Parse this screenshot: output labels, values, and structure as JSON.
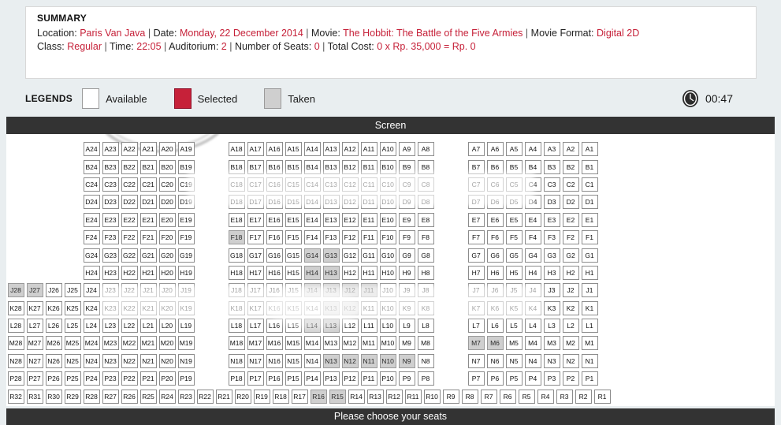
{
  "summary": {
    "title": "SUMMARY",
    "location_label": "Location:",
    "location_value": "Paris Van Java",
    "date_label": "Date:",
    "date_value": "Monday, 22 December 2014",
    "movie_label": "Movie:",
    "movie_value": "The Hobbit: The Battle of the Five Armies",
    "format_label": "Movie Format:",
    "format_value": "Digital 2D",
    "class_label": "Class:",
    "class_value": "Regular",
    "time_label": "Time:",
    "time_value": "22:05",
    "auditorium_label": "Auditorium:",
    "auditorium_value": "2",
    "seats_label": "Number of Seats:",
    "seats_value": "0",
    "cost_label": "Total Cost:",
    "cost_value": "0 x Rp. 35,000 = Rp. 0",
    "divider": "|"
  },
  "legends": {
    "label": "LEGENDS",
    "items": [
      {
        "name": "available",
        "text": "Available",
        "color": "#ffffff"
      },
      {
        "name": "selected",
        "text": "Selected",
        "color": "#c62139"
      },
      {
        "name": "taken",
        "text": "Taken",
        "color": "#cfcfcf"
      }
    ],
    "clock_icon": "clock-icon",
    "timer": "00:47"
  },
  "screen": {
    "label": "Screen"
  },
  "footer": {
    "message": "Please choose your seats"
  },
  "seatmap": {
    "taken_seats": [
      "F18",
      "G14",
      "G13",
      "H14",
      "H13",
      "J28",
      "J27",
      "J14",
      "J13",
      "J12",
      "J11",
      "K13",
      "K12",
      "L14",
      "L13",
      "M7",
      "M6",
      "N13",
      "N12",
      "N11",
      "N10",
      "N9",
      "R16",
      "R15"
    ],
    "selected_seats": [],
    "rows": [
      {
        "row": "A",
        "indent": 96,
        "left": [
          24,
          23,
          22,
          21,
          20,
          19
        ],
        "middle": [
          18,
          17,
          16,
          15,
          14,
          13,
          12,
          11,
          10,
          9,
          8
        ],
        "right": [
          7,
          6,
          5,
          4,
          3,
          2,
          1
        ]
      },
      {
        "row": "B",
        "indent": 96,
        "left": [
          24,
          23,
          22,
          21,
          20,
          19
        ],
        "middle": [
          18,
          17,
          16,
          15,
          14,
          13,
          12,
          11,
          10,
          9,
          8
        ],
        "right": [
          7,
          6,
          5,
          4,
          3,
          2,
          1
        ]
      },
      {
        "row": "C",
        "indent": 96,
        "left": [
          24,
          23,
          22,
          21,
          20,
          19
        ],
        "middle": [
          18,
          17,
          16,
          15,
          14,
          13,
          12,
          11,
          10,
          9,
          8
        ],
        "right": [
          7,
          6,
          5,
          4,
          3,
          2,
          1
        ]
      },
      {
        "row": "D",
        "indent": 96,
        "left": [
          24,
          23,
          22,
          21,
          20,
          19
        ],
        "middle": [
          18,
          17,
          16,
          15,
          14,
          13,
          12,
          11,
          10,
          9,
          8
        ],
        "right": [
          7,
          6,
          5,
          4,
          3,
          2,
          1
        ]
      },
      {
        "row": "E",
        "indent": 96,
        "left": [
          24,
          23,
          22,
          21,
          20,
          19
        ],
        "middle": [
          18,
          17,
          16,
          15,
          14,
          13,
          12,
          11,
          10,
          9,
          8
        ],
        "right": [
          7,
          6,
          5,
          4,
          3,
          2,
          1
        ]
      },
      {
        "row": "F",
        "indent": 96,
        "left": [
          24,
          23,
          22,
          21,
          20,
          19
        ],
        "middle": [
          18,
          17,
          16,
          15,
          14,
          13,
          12,
          11,
          10,
          9,
          8
        ],
        "right": [
          7,
          6,
          5,
          4,
          3,
          2,
          1
        ]
      },
      {
        "row": "G",
        "indent": 96,
        "left": [
          24,
          23,
          22,
          21,
          20,
          19
        ],
        "middle": [
          18,
          17,
          16,
          15,
          14,
          13,
          12,
          11,
          10,
          9,
          8
        ],
        "right": [
          7,
          6,
          5,
          4,
          3,
          2,
          1
        ]
      },
      {
        "row": "H",
        "indent": 96,
        "left": [
          24,
          23,
          22,
          21,
          20,
          19
        ],
        "middle": [
          18,
          17,
          16,
          15,
          14,
          13,
          12,
          11,
          10,
          9,
          8
        ],
        "right": [
          7,
          6,
          5,
          4,
          3,
          2,
          1
        ]
      },
      {
        "row": "J",
        "indent": 0,
        "left": [
          28,
          27,
          26,
          25,
          24,
          23,
          22,
          21,
          20,
          19
        ],
        "middle": [
          18,
          17,
          16,
          15,
          14,
          13,
          12,
          11,
          10,
          9,
          8
        ],
        "right": [
          7,
          6,
          5,
          4,
          3,
          2,
          1
        ]
      },
      {
        "row": "K",
        "indent": 0,
        "left": [
          28,
          27,
          26,
          25,
          24,
          23,
          22,
          21,
          20,
          19
        ],
        "middle": [
          18,
          17,
          16,
          15,
          14,
          13,
          12,
          11,
          10,
          9,
          8
        ],
        "right": [
          7,
          6,
          5,
          4,
          3,
          2,
          1
        ]
      },
      {
        "row": "L",
        "indent": 0,
        "left": [
          28,
          27,
          26,
          25,
          24,
          23,
          22,
          21,
          20,
          19
        ],
        "middle": [
          18,
          17,
          16,
          15,
          14,
          13,
          12,
          11,
          10,
          9,
          8
        ],
        "right": [
          7,
          6,
          5,
          4,
          3,
          2,
          1
        ]
      },
      {
        "row": "M",
        "indent": 0,
        "left": [
          28,
          27,
          26,
          25,
          24,
          23,
          22,
          21,
          20,
          19
        ],
        "middle": [
          18,
          17,
          16,
          15,
          14,
          13,
          12,
          11,
          10,
          9,
          8
        ],
        "right": [
          7,
          6,
          5,
          4,
          3,
          2,
          1
        ]
      },
      {
        "row": "N",
        "indent": 0,
        "left": [
          28,
          27,
          26,
          25,
          24,
          23,
          22,
          21,
          20,
          19
        ],
        "middle": [
          18,
          17,
          16,
          15,
          14,
          13,
          12,
          11,
          10,
          9,
          8
        ],
        "right": [
          7,
          6,
          5,
          4,
          3,
          2,
          1
        ]
      },
      {
        "row": "P",
        "indent": 0,
        "left": [
          28,
          27,
          26,
          25,
          24,
          23,
          22,
          21,
          20,
          19
        ],
        "middle": [
          18,
          17,
          16,
          15,
          14,
          13,
          12,
          11,
          10,
          9,
          8
        ],
        "right": [
          7,
          6,
          5,
          4,
          3,
          2,
          1
        ]
      },
      {
        "row": "R",
        "indent": 0,
        "continuous": [
          32,
          31,
          30,
          29,
          28,
          27,
          26,
          25,
          24,
          23,
          22,
          21,
          20,
          19,
          18,
          17,
          16,
          15,
          14,
          13,
          12,
          11,
          10,
          9,
          8,
          7,
          6,
          5,
          4,
          3,
          2,
          1
        ]
      }
    ]
  }
}
